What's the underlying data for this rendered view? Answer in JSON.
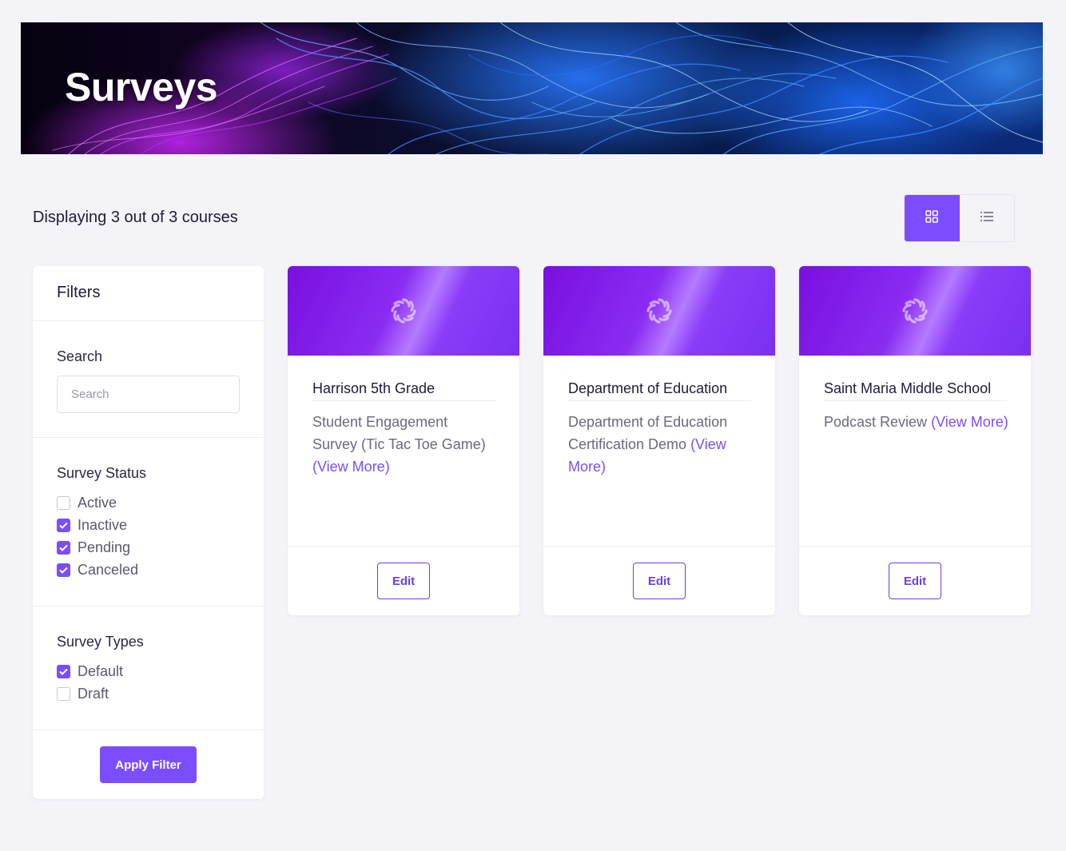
{
  "banner": {
    "title": "Surveys"
  },
  "toolbar": {
    "count_text": "Displaying 3 out of 3 courses",
    "view_modes": [
      {
        "name": "grid",
        "icon": "grid-icon",
        "active": true
      },
      {
        "name": "list",
        "icon": "list-icon",
        "active": false
      }
    ]
  },
  "filters": {
    "title": "Filters",
    "search": {
      "label": "Search",
      "placeholder": "Search",
      "value": ""
    },
    "status": {
      "label": "Survey Status",
      "options": [
        {
          "label": "Active",
          "checked": false
        },
        {
          "label": "Inactive",
          "checked": true
        },
        {
          "label": "Pending",
          "checked": true
        },
        {
          "label": "Canceled",
          "checked": true
        }
      ]
    },
    "types": {
      "label": "Survey Types",
      "options": [
        {
          "label": "Default",
          "checked": true
        },
        {
          "label": "Draft",
          "checked": false
        }
      ]
    },
    "apply_label": "Apply Filter"
  },
  "cards": [
    {
      "title": "Harrison 5th Grade",
      "desc_lines": [
        "Student Engagement",
        "Survey (Tic Tac Toe Game)"
      ],
      "more_label": "(View More)",
      "edit_label": "Edit"
    },
    {
      "title": "Department of Education",
      "desc_lines": [
        "Department of Education",
        "Certification Demo "
      ],
      "more_label": "(View More)",
      "edit_label": "Edit"
    },
    {
      "title": "Saint Maria Middle School",
      "desc_lines": [
        "Podcast Review "
      ],
      "more_label": "(View More)",
      "edit_label": "Edit"
    }
  ],
  "colors": {
    "accent": "#7b4dff",
    "background": "#f4f4f8",
    "text": "#1e1b3a",
    "muted": "#6a6880"
  }
}
